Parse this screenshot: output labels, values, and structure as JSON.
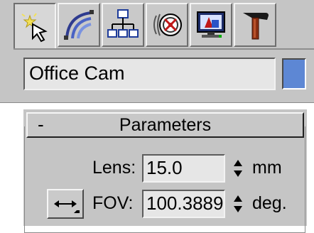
{
  "command_panel": {
    "tabs": [
      {
        "name": "create",
        "icon": "create-wand-icon",
        "active": true
      },
      {
        "name": "modify",
        "icon": "modify-curve-icon",
        "active": false
      },
      {
        "name": "hierarchy",
        "icon": "hierarchy-icon",
        "active": false
      },
      {
        "name": "motion",
        "icon": "motion-wheel-icon",
        "active": false
      },
      {
        "name": "display",
        "icon": "display-monitor-icon",
        "active": false
      },
      {
        "name": "utilities",
        "icon": "hammer-icon",
        "active": false
      }
    ],
    "object_name": "Office Cam",
    "object_color": "#5d87d4"
  },
  "parameters": {
    "collapse_symbol": "-",
    "title": "Parameters",
    "lens": {
      "label": "Lens:",
      "value": "15.0",
      "unit": "mm"
    },
    "fov": {
      "label": "FOV:",
      "value": "100.3889",
      "unit": "deg.",
      "direction_icon": "horizontal-arrows-icon"
    }
  }
}
